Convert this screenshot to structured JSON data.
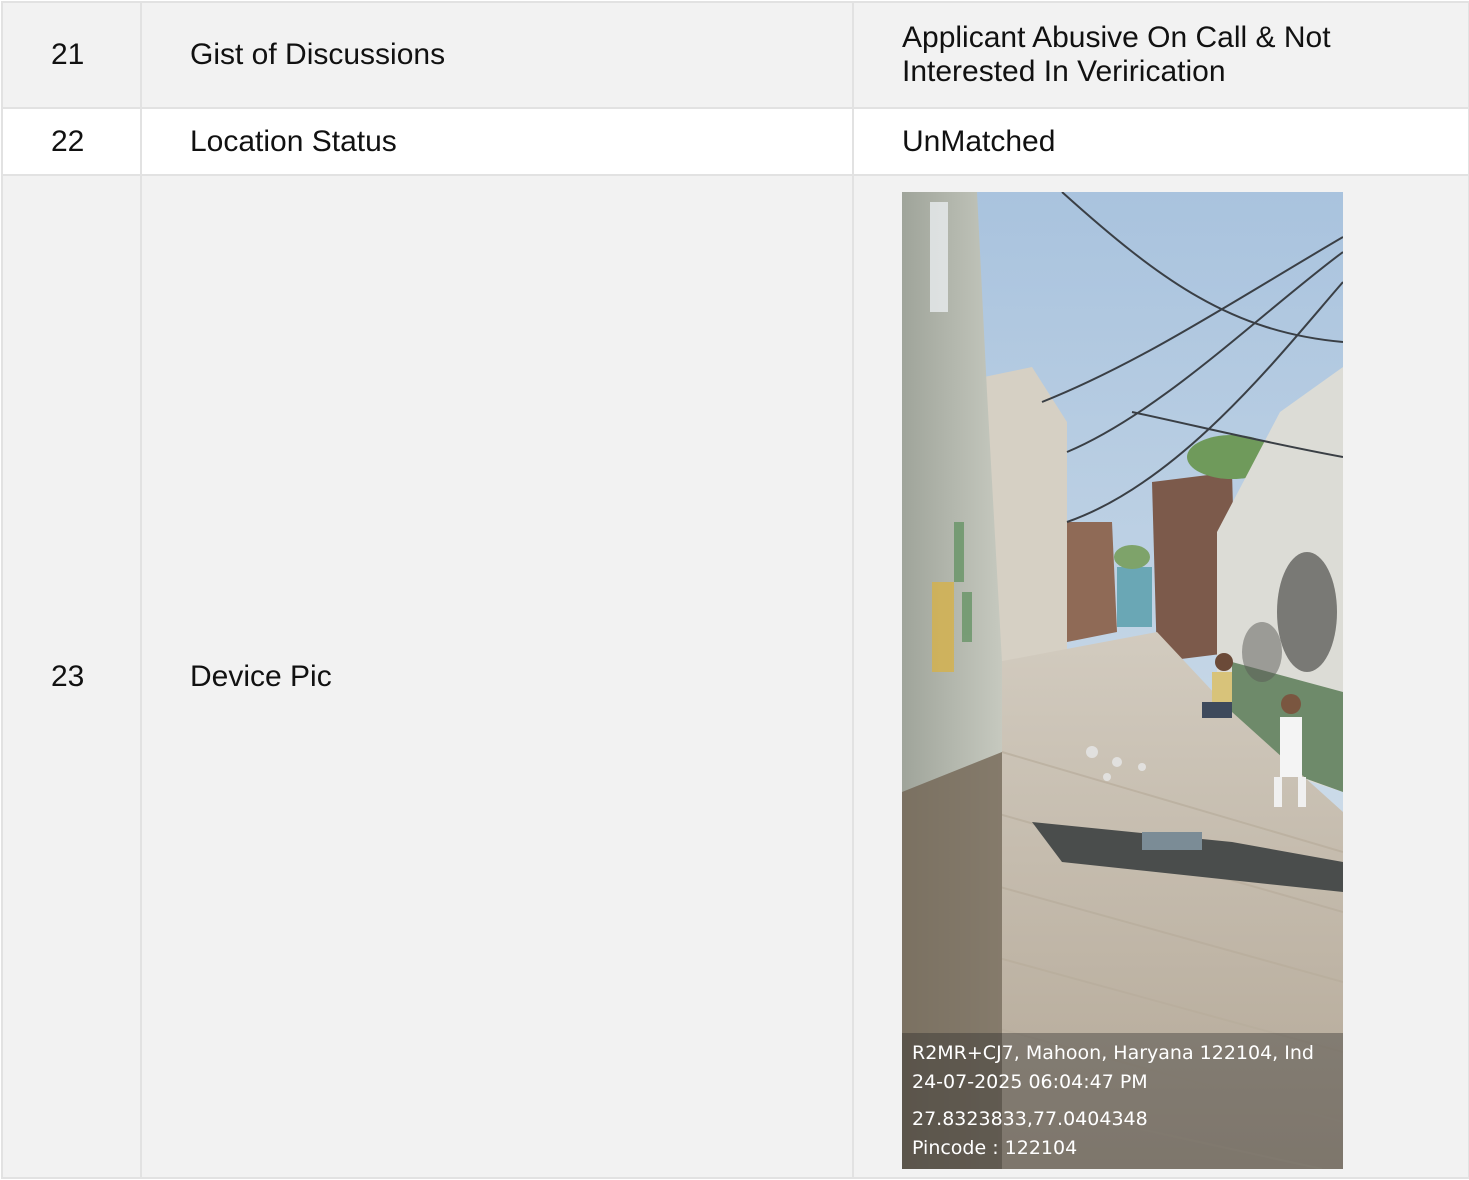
{
  "rows": [
    {
      "num": "21",
      "label": "Gist of Discussions",
      "value": "Applicant Abusive On Call & Not Interested In Verirication"
    },
    {
      "num": "22",
      "label": "Location Status",
      "value": "UnMatched"
    },
    {
      "num": "23",
      "label": "Device Pic"
    }
  ],
  "photo_overlay": {
    "address": "R2MR+CJ7, Mahoon, Haryana 122104, Ind",
    "datetime": "24-07-2025 06:04:47 PM",
    "coordinates": "27.8323833,77.0404348",
    "pincode": "Pincode : 122104"
  },
  "colors": {
    "row_shade": "#f2f2f2",
    "row_plain": "#ffffff",
    "border": "#e2e2e2"
  }
}
